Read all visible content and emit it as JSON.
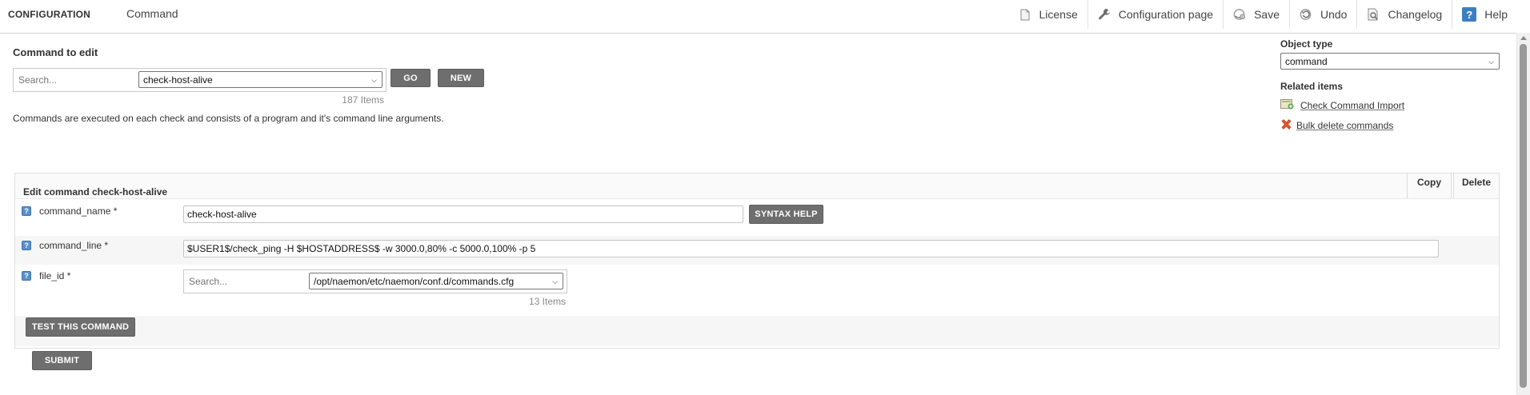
{
  "header": {
    "brand": "CONFIGURATION",
    "page_name": "Command",
    "tools": [
      {
        "label": "License",
        "icon": "document-icon"
      },
      {
        "label": "Configuration page",
        "icon": "wrench-icon"
      },
      {
        "label": "Save",
        "icon": "save-icon"
      },
      {
        "label": "Undo",
        "icon": "undo-icon"
      },
      {
        "label": "Changelog",
        "icon": "changelog-icon"
      },
      {
        "label": "Help",
        "icon": "help-icon"
      }
    ]
  },
  "command_to_edit": {
    "title": "Command to edit",
    "search_placeholder": "Search...",
    "selected": "check-host-alive",
    "go_label": "GO",
    "new_label": "NEW",
    "count": "187 Items",
    "description": "Commands are executed on each check and consists of a program and it's command line arguments."
  },
  "right_panel": {
    "object_type_label": "Object type",
    "object_type_value": "command",
    "related_label": "Related items",
    "related": [
      {
        "label": "Check Command Import",
        "icon": "import-icon"
      },
      {
        "label": "Bulk delete commands",
        "icon": "delete-x-icon"
      }
    ]
  },
  "edit": {
    "title": "Edit command check-host-alive",
    "copy_label": "Copy",
    "delete_label": "Delete",
    "fields": {
      "command_name": {
        "label": "command_name *",
        "value": "check-host-alive",
        "syntax_help": "SYNTAX HELP"
      },
      "command_line": {
        "label": "command_line *",
        "value": "$USER1$/check_ping -H $HOSTADDRESS$ -w 3000.0,80% -c 5000.0,100% -p 5"
      },
      "file_id": {
        "label": "file_id *",
        "search_placeholder": "Search...",
        "value": "/opt/naemon/etc/naemon/conf.d/commands.cfg",
        "count": "13 Items"
      }
    },
    "test_label": "TEST THIS COMMAND",
    "submit_label": "SUBMIT"
  },
  "colors": {
    "button_bg": "#6e6e6e",
    "help_icon": "#3d7ec1",
    "delete_icon": "#e0552a"
  }
}
